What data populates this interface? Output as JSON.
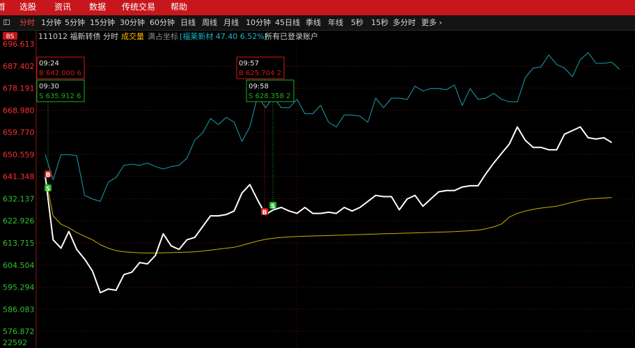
{
  "menu": [
    "首",
    "选股",
    "资讯",
    "数据",
    "传统交易",
    "帮助"
  ],
  "periods": [
    "分时",
    "1分钟",
    "5分钟",
    "15分钟",
    "30分钟",
    "60分钟",
    "日线",
    "周线",
    "月线",
    "10分钟",
    "45日线",
    "季线",
    "年线",
    "5秒",
    "15秒",
    "多分时",
    "更多"
  ],
  "active_period": "分时",
  "more_icon": "chevron-right-icon",
  "info": {
    "badge": "BS",
    "code_name": "111012 福新转债",
    "mode": "分时",
    "volume_label": "成交量",
    "coord_label": "满占坐标",
    "sector": "[福莱新材 47.40 6.52%]",
    "account": "所有已登录账户"
  },
  "colors": {
    "price_line": "#ffffff",
    "avg_line": "#c8b400",
    "stock_line": "#17a3b0",
    "up_label": "#ff2d2d",
    "down_label": "#2fc02f",
    "buy_box": "#d01818",
    "sell_box": "#20b020",
    "menubar": "#c8161d"
  },
  "chart_data": {
    "type": "line",
    "ylim": [
      572.266,
      696.613
    ],
    "yticks": [
      {
        "value": 696.613,
        "label": "696.613",
        "color": "up"
      },
      {
        "value": 687.402,
        "label": "687.402",
        "color": "up"
      },
      {
        "value": 678.191,
        "label": "678.191",
        "color": "up"
      },
      {
        "value": 668.98,
        "label": "668.980",
        "color": "up"
      },
      {
        "value": 659.77,
        "label": "659.770",
        "color": "up"
      },
      {
        "value": 650.559,
        "label": "650.559",
        "color": "up"
      },
      {
        "value": 641.348,
        "label": "641.348",
        "color": "up"
      },
      {
        "value": 632.137,
        "label": "632.137",
        "color": "down"
      },
      {
        "value": 622.926,
        "label": "622.926",
        "color": "down"
      },
      {
        "value": 613.715,
        "label": "613.715",
        "color": "down"
      },
      {
        "value": 604.504,
        "label": "604.504",
        "color": "down"
      },
      {
        "value": 595.294,
        "label": "595.294",
        "color": "down"
      },
      {
        "value": 586.083,
        "label": "586.083",
        "color": "down"
      },
      {
        "value": 576.872,
        "label": "576.872",
        "color": "down"
      },
      {
        "value": 572.266,
        "label": "22592",
        "color": "down"
      }
    ],
    "series": [
      {
        "key": "price",
        "values": [
          641.5,
          615.0,
          611.5,
          618.5,
          611.0,
          607.0,
          602.0,
          593.0,
          594.5,
          594.0,
          600.5,
          601.5,
          605.5,
          605.0,
          608.5,
          617.5,
          612.5,
          611.0,
          615.0,
          616.0,
          620.5,
          625.0,
          625.0,
          625.5,
          627.0,
          634.5,
          638.0,
          631.5,
          625.5,
          627.5,
          628.5,
          627.0,
          626.0,
          628.5,
          626.0,
          626.0,
          626.5,
          626.0,
          628.5,
          627.0,
          628.5,
          631.0,
          633.5,
          633.0,
          633.0,
          627.5,
          632.0,
          633.5,
          629.0,
          632.0,
          635.0,
          635.5,
          635.5,
          637.0,
          637.5,
          637.5,
          642.5,
          647.0,
          651.0,
          655.0,
          662.0,
          656.5,
          653.5,
          653.5,
          652.5,
          652.5,
          659.0,
          660.5,
          662.0,
          657.5,
          657.0,
          657.5,
          655.5
        ]
      },
      {
        "key": "avg",
        "values": [
          641.5,
          625.0,
          621.5,
          620.0,
          618.0,
          616.5,
          615.0,
          613.0,
          611.5,
          610.5,
          610.0,
          609.8,
          609.6,
          609.5,
          609.5,
          609.6,
          609.7,
          609.8,
          609.9,
          610.0,
          610.3,
          610.7,
          611.1,
          611.5,
          611.9,
          612.7,
          613.6,
          614.5,
          615.2,
          615.7,
          616.0,
          616.2,
          616.4,
          616.5,
          616.6,
          616.7,
          616.8,
          616.9,
          617.0,
          617.1,
          617.2,
          617.3,
          617.4,
          617.5,
          617.6,
          617.7,
          617.8,
          617.9,
          618.0,
          618.1,
          618.2,
          618.3,
          618.4,
          618.6,
          618.8,
          619.0,
          619.6,
          620.4,
          621.6,
          624.5,
          626.0,
          627.0,
          627.7,
          628.2,
          628.6,
          629.0,
          629.8,
          630.6,
          631.4,
          632.0,
          632.2,
          632.4,
          632.6
        ]
      },
      {
        "key": "stock",
        "values": [
          650.5,
          640.0,
          650.5,
          650.5,
          650.0,
          633.5,
          632.0,
          631.0,
          639.0,
          641.0,
          646.0,
          646.5,
          646.0,
          647.0,
          645.5,
          644.5,
          645.5,
          646.0,
          649.0,
          656.5,
          659.5,
          665.5,
          663.0,
          666.0,
          664.0,
          656.0,
          662.0,
          675.0,
          670.0,
          674.5,
          670.0,
          670.0,
          673.5,
          667.5,
          667.5,
          671.0,
          664.0,
          662.0,
          667.0,
          667.0,
          666.5,
          664.0,
          674.0,
          670.0,
          674.0,
          674.0,
          673.5,
          679.0,
          677.0,
          678.0,
          678.0,
          677.5,
          679.5,
          671.0,
          678.0,
          673.5,
          674.0,
          676.0,
          673.5,
          672.5,
          672.5,
          682.5,
          686.5,
          687.0,
          692.0,
          688.0,
          686.5,
          683.0,
          690.0,
          693.0,
          688.5,
          688.5,
          689.0,
          686.0
        ]
      }
    ],
    "trades": [
      {
        "idx": 1,
        "side": "B",
        "box_time": "09:24",
        "box_text": "B 642.000  6",
        "price": 642.0
      },
      {
        "idx": 1,
        "side": "S",
        "box_time": "09:30",
        "box_text": "S 635.912  6",
        "price": 635.912
      },
      {
        "idx": 26,
        "side": "B",
        "box_time": "09:57",
        "box_text": "B 625.704  2",
        "price": 625.704
      },
      {
        "idx": 28,
        "side": "S",
        "box_time": "09:58",
        "box_text": "S 628.358  2",
        "price": 628.358
      }
    ]
  }
}
